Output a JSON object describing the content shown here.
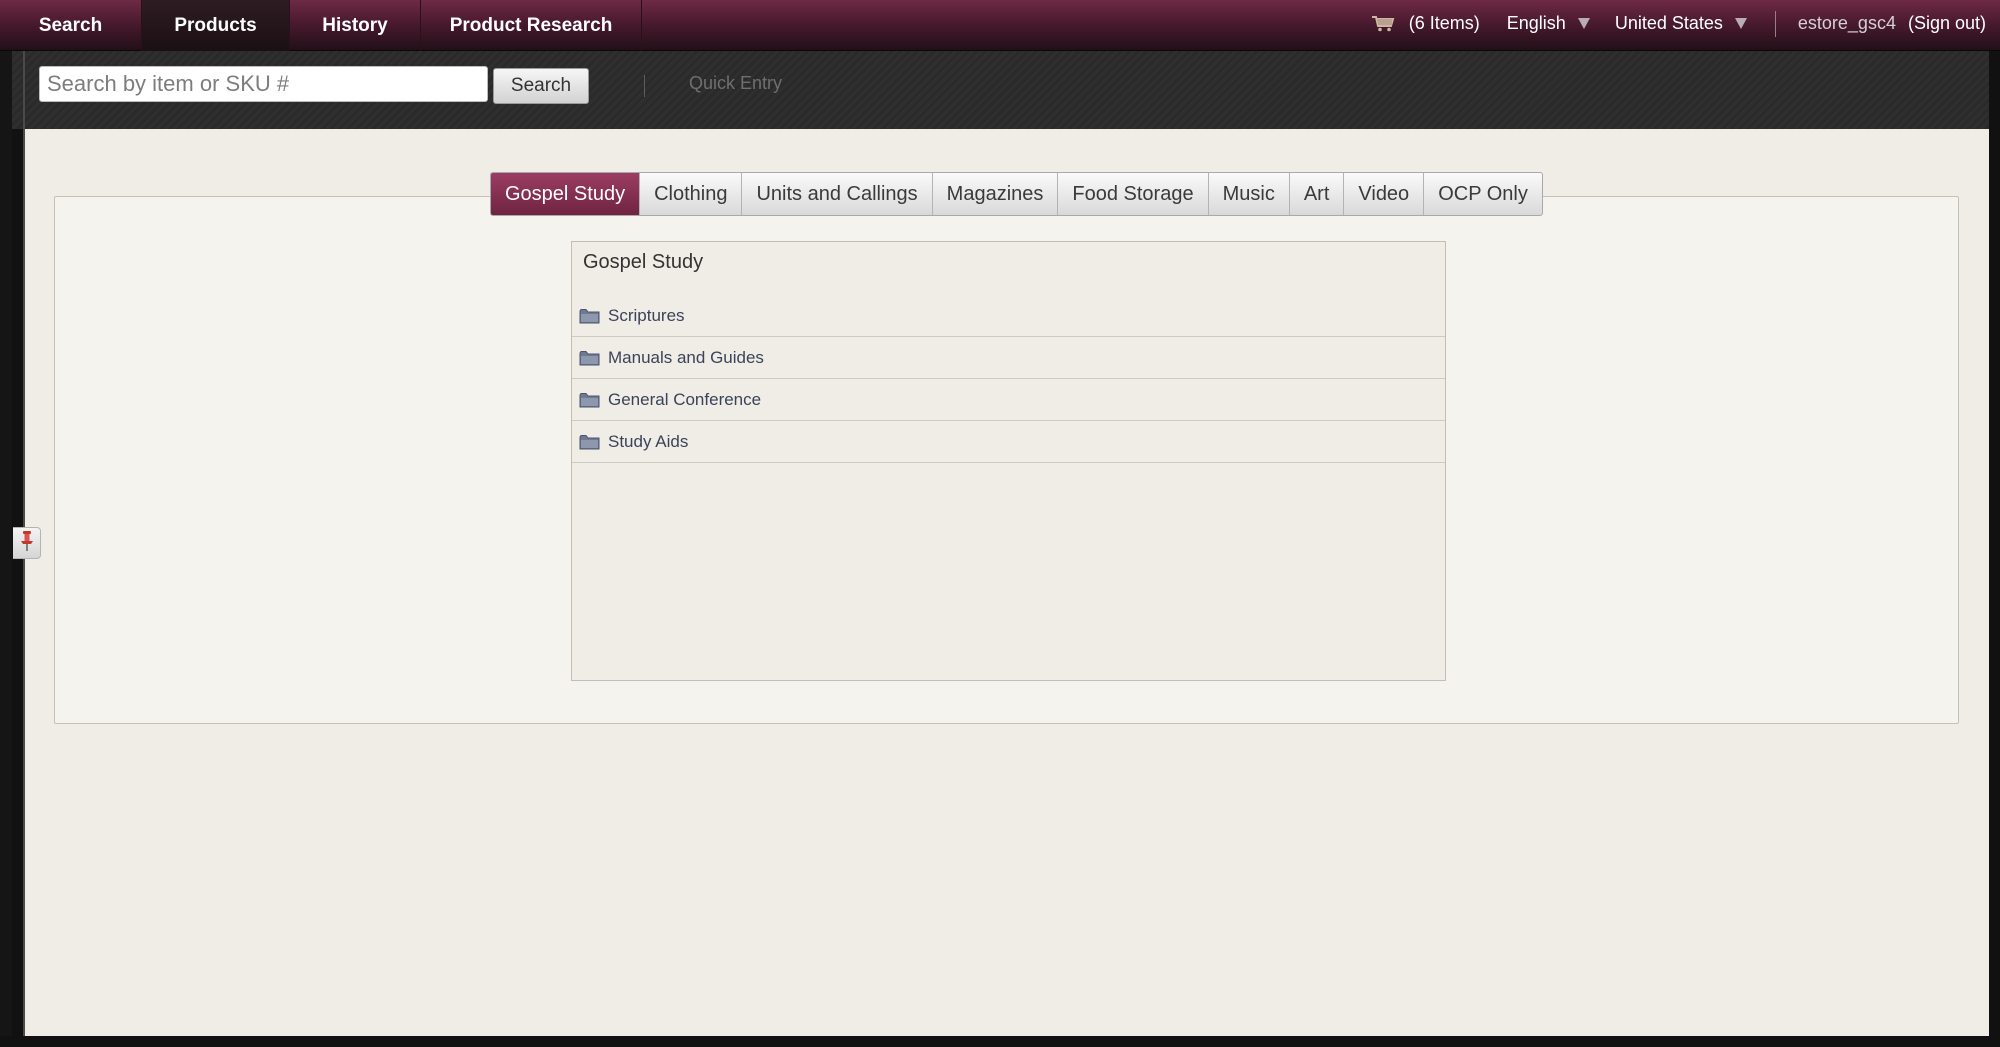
{
  "nav": {
    "tabs": [
      {
        "label": "Search",
        "active": false
      },
      {
        "label": "Products",
        "active": true
      },
      {
        "label": "History",
        "active": false
      },
      {
        "label": "Product Research",
        "active": false
      }
    ],
    "cart_icon": "shopping-cart-icon",
    "cart_label": "(6 Items)",
    "language": "English",
    "country": "United States",
    "username": "estore_gsc4",
    "signout": "(Sign out)"
  },
  "search": {
    "placeholder": "Search by item or SKU #",
    "value": "",
    "button_label": "Search",
    "quick_entry_label": "Quick Entry"
  },
  "categories": {
    "tabs": [
      {
        "label": "Gospel Study",
        "active": true
      },
      {
        "label": "Clothing",
        "active": false
      },
      {
        "label": "Units and Callings",
        "active": false
      },
      {
        "label": "Magazines",
        "active": false
      },
      {
        "label": "Food Storage",
        "active": false
      },
      {
        "label": "Music",
        "active": false
      },
      {
        "label": "Art",
        "active": false
      },
      {
        "label": "Video",
        "active": false
      },
      {
        "label": "OCP Only",
        "active": false
      }
    ]
  },
  "subcategory": {
    "title": "Gospel Study",
    "folder_icon": "folder-icon",
    "items": [
      {
        "label": "Scriptures"
      },
      {
        "label": "Manuals and Guides"
      },
      {
        "label": "General Conference"
      },
      {
        "label": "Study Aids"
      }
    ]
  },
  "pin_icon": "pushpin-icon",
  "colors": {
    "brand": "#6f2440",
    "nav_bg": "#4a1a2e",
    "content_bg": "#f0ede6",
    "link_text": "#3a4358"
  }
}
